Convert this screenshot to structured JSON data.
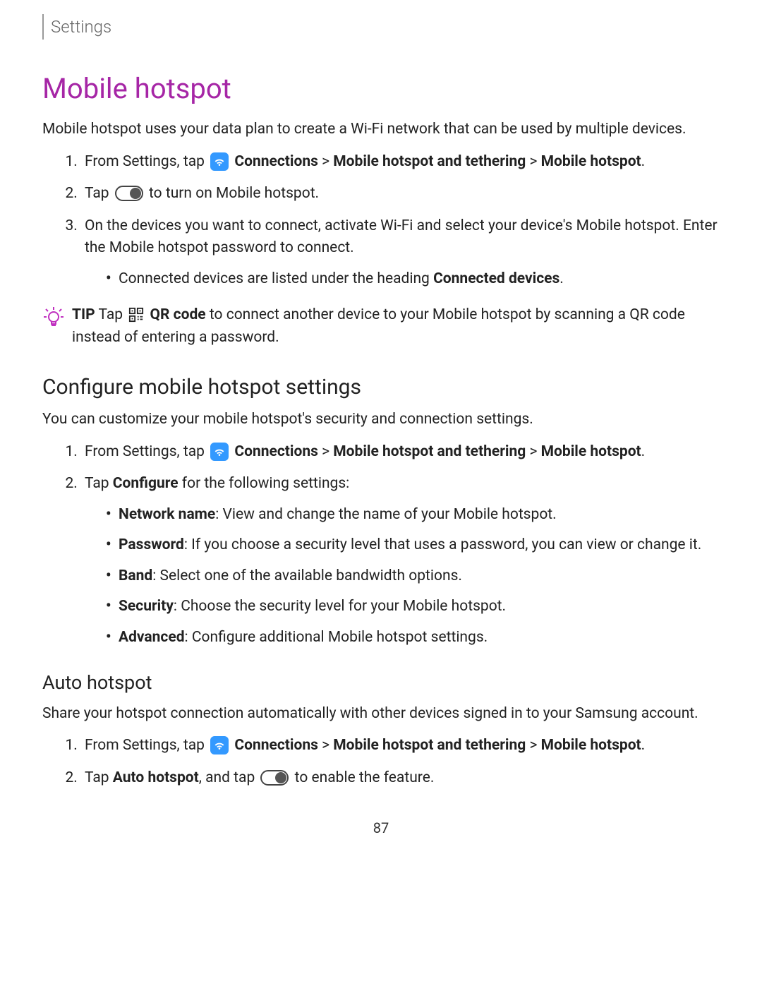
{
  "breadcrumb": "Settings",
  "page_number": "87",
  "heading": "Mobile hotspot",
  "intro": "Mobile hotspot uses your data plan to create a Wi-Fi network that can be used by multiple devices.",
  "steps1": {
    "s1_pre": "From Settings, tap ",
    "s1_b1": "Connections",
    "s1_sep1": " > ",
    "s1_b2": "Mobile hotspot and tethering",
    "s1_sep2": " > ",
    "s1_b3": "Mobile hotspot",
    "s1_period": ".",
    "s2_pre": "Tap ",
    "s2_post": " to turn on Mobile hotspot.",
    "s3": "On the devices you want to connect, activate Wi-Fi and select your device's Mobile hotspot. Enter the Mobile hotspot password to connect.",
    "s3_sub_pre": "Connected devices are listed under the heading ",
    "s3_sub_bold": "Connected devices",
    "s3_sub_period": "."
  },
  "tip": {
    "label": "TIP",
    "pre": "  Tap ",
    "bold": "QR code",
    "post": " to connect another device to your Mobile hotspot by scanning a QR code instead of entering a password."
  },
  "configure": {
    "heading": "Configure mobile hotspot settings",
    "intro": "You can customize your mobile hotspot's security and connection settings.",
    "s1_pre": "From Settings, tap ",
    "s1_b1": "Connections",
    "s1_sep1": " > ",
    "s1_b2": "Mobile hotspot and tethering",
    "s1_sep2": " > ",
    "s1_b3": "Mobile hotspot",
    "s1_period": ".",
    "s2_pre": "Tap ",
    "s2_bold": "Configure",
    "s2_post": " for the following settings:",
    "items": {
      "net_b": "Network name",
      "net_t": ": View and change the name of your Mobile hotspot.",
      "pwd_b": "Password",
      "pwd_t": ": If you choose a security level that uses a password, you can view or change it.",
      "band_b": "Band",
      "band_t": ": Select one of the available bandwidth options.",
      "sec_b": "Security",
      "sec_t": ": Choose the security level for your Mobile hotspot.",
      "adv_b": "Advanced",
      "adv_t": ": Configure additional Mobile hotspot settings."
    }
  },
  "auto": {
    "heading": "Auto hotspot",
    "intro": "Share your hotspot connection automatically with other devices signed in to your Samsung account.",
    "s1_pre": "From Settings, tap ",
    "s1_b1": "Connections",
    "s1_sep1": " > ",
    "s1_b2": "Mobile hotspot and tethering",
    "s1_sep2": " > ",
    "s1_b3": "Mobile hotspot",
    "s1_period": ".",
    "s2_pre": "Tap ",
    "s2_bold": "Auto hotspot",
    "s2_mid": ", and tap ",
    "s2_post": " to enable the feature."
  }
}
